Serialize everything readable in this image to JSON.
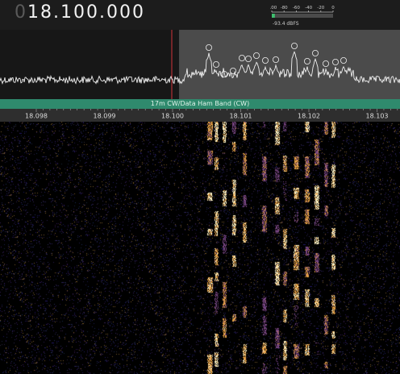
{
  "frequency": {
    "leading_digit": "0",
    "value": "18.100.000"
  },
  "smeter": {
    "ticks": [
      "-100",
      "-80",
      "-60",
      "-40",
      "-20",
      "0"
    ],
    "readout": "-93.4 dBFS",
    "level_fraction": 0.05,
    "bar_color": "#3fbf6f"
  },
  "band": {
    "label": "17m CW/Data Ham Band (CW)",
    "color": "#2f8a6d"
  },
  "scale": {
    "labels": [
      "18.098",
      "18.099",
      "18.100",
      "18.101",
      "18.102",
      "18.103"
    ],
    "tuned": "18.100"
  },
  "colors": {
    "tuned_marker": "#d2333a",
    "passband": "rgba(140,140,140,0.45)",
    "trace": "#f0f0f0"
  }
}
